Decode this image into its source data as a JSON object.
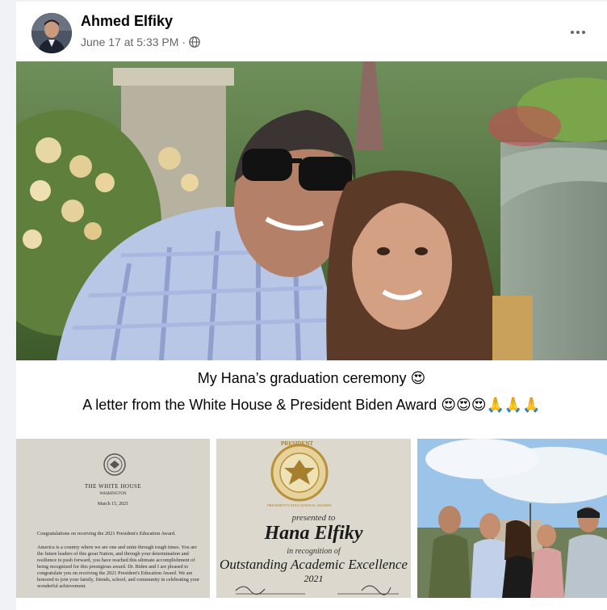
{
  "post": {
    "author": "Ahmed Elfiky",
    "timestamp": "June 17 at 5:33 PM",
    "separator": "·",
    "audience_icon": "globe-icon",
    "more_icon": "more-options-icon",
    "caption_line1_text": "My Hana’s graduation ceremony",
    "caption_line1_emoji": "😍",
    "caption_line2_text": "A letter from the White House & President Biden Award",
    "caption_line2_emoji": "😍😍😍🙏🙏🙏"
  },
  "letter": {
    "header": "THE WHITE HOUSE",
    "sub": "WASHINGTON",
    "date": "March 15, 2021",
    "p1": "Congratulations on receiving the 2021 President's Education Award.",
    "p2": "America is a country where we are one and unite through tough times. You are the future leaders of this great Nation, and through your determination and resilience to push forward, you have reached this ultimate accomplishment of being recognized for this prestigious award. Dr. Biden and I are pleased to congratulate you on receiving the 2021 President's Education Award. We are honored to join your family, friends, school, and community in celebrating your wonderful achievement."
  },
  "certificate": {
    "seal_top": "PRESIDENT",
    "seal_ring": "PRESIDENT'S EDUCATIONAL AWARDS",
    "presented": "presented to",
    "name": "Hana Elfiky",
    "recognition": "in recognition of",
    "award": "Outstanding Academic Excellence",
    "year": "2021"
  },
  "colors": {
    "text_primary": "#050505",
    "text_secondary": "#65676b",
    "background": "#f0f2f5",
    "card": "#ffffff"
  }
}
